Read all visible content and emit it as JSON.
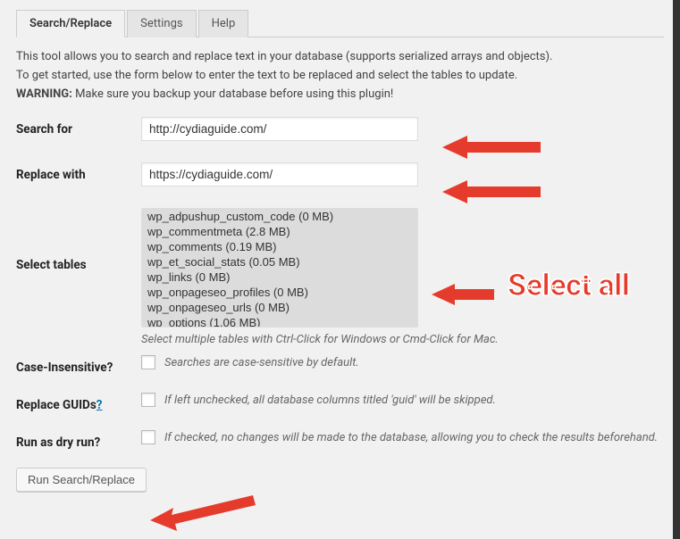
{
  "tabs": {
    "search_replace": "Search/Replace",
    "settings": "Settings",
    "help": "Help"
  },
  "intro": {
    "line1": "This tool allows you to search and replace text in your database (supports serialized arrays and objects).",
    "line2": "To get started, use the form below to enter the text to be replaced and select the tables to update.",
    "warning_label": "WARNING:",
    "warning_text": " Make sure you backup your database before using this plugin!"
  },
  "labels": {
    "search_for": "Search for",
    "replace_with": "Replace with",
    "select_tables": "Select tables",
    "case_insensitive": "Case-Insensitive?",
    "replace_guids": "Replace GUIDs",
    "replace_guids_q": "?",
    "dry_run": "Run as dry run?"
  },
  "fields": {
    "search_for": "http://cydiaguide.com/",
    "replace_with": "https://cydiaguide.com/"
  },
  "tables": [
    "wp_adpushup_custom_code (0 MB)",
    "wp_commentmeta (2.8 MB)",
    "wp_comments (0.19 MB)",
    "wp_et_social_stats (0.05 MB)",
    "wp_links (0 MB)",
    "wp_onpageseo_profiles (0 MB)",
    "wp_onpageseo_urls (0 MB)",
    "wp_options (1.06 MB)"
  ],
  "hints": {
    "tables": "Select multiple tables with Ctrl-Click for Windows or Cmd-Click for Mac.",
    "case": "Searches are case-sensitive by default.",
    "guids": "If left unchecked, all database columns titled 'guid' will be skipped.",
    "dry": "If checked, no changes will be made to the database, allowing you to check the results beforehand."
  },
  "buttons": {
    "run": "Run Search/Replace"
  },
  "callout": {
    "select_all": "Select all"
  }
}
